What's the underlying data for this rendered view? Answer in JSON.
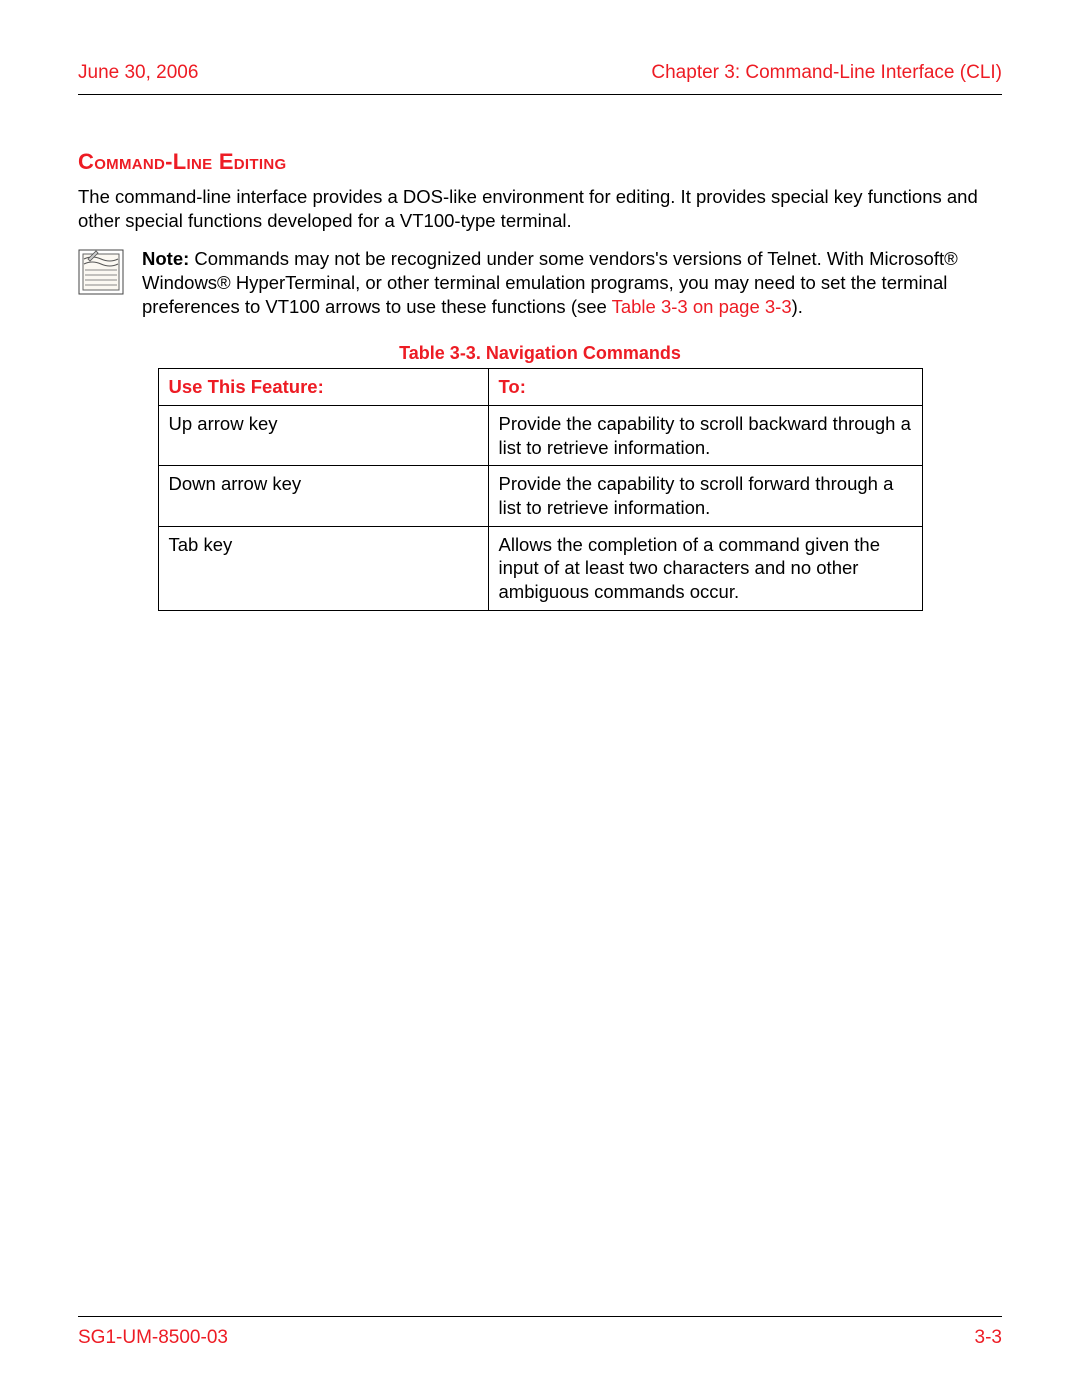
{
  "header": {
    "date": "June 30, 2006",
    "chapter": "Chapter 3: Command-Line Interface (CLI)"
  },
  "section": {
    "title": "Command-Line Editing",
    "intro": "The command-line interface provides a DOS-like environment for editing. It provides special key functions and other special functions developed for a VT100-type terminal."
  },
  "note": {
    "label": "Note:",
    "text_before": " Commands may not be recognized under some vendors's versions of Telnet. With Microsoft® Windows® HyperTerminal, or other terminal emulation programs, you may need to set the terminal preferences to VT100 arrows to use these functions (see ",
    "xref": "Table 3-3 on page 3-3",
    "text_after": ")."
  },
  "table": {
    "caption": "Table 3-3. Navigation Commands",
    "head": {
      "col1": "Use This Feature:",
      "col2": "To:"
    },
    "rows": [
      {
        "feature": "Up arrow key",
        "to": "Provide the capability to scroll backward through a list to retrieve information."
      },
      {
        "feature": "Down arrow key",
        "to": "Provide the capability to scroll forward through a list to retrieve information."
      },
      {
        "feature": "Tab key",
        "to": "Allows the completion of a command given the input of at least two characters and no other ambiguous commands occur."
      }
    ]
  },
  "footer": {
    "doc_id": "SG1-UM-8500-03",
    "page": "3-3"
  }
}
